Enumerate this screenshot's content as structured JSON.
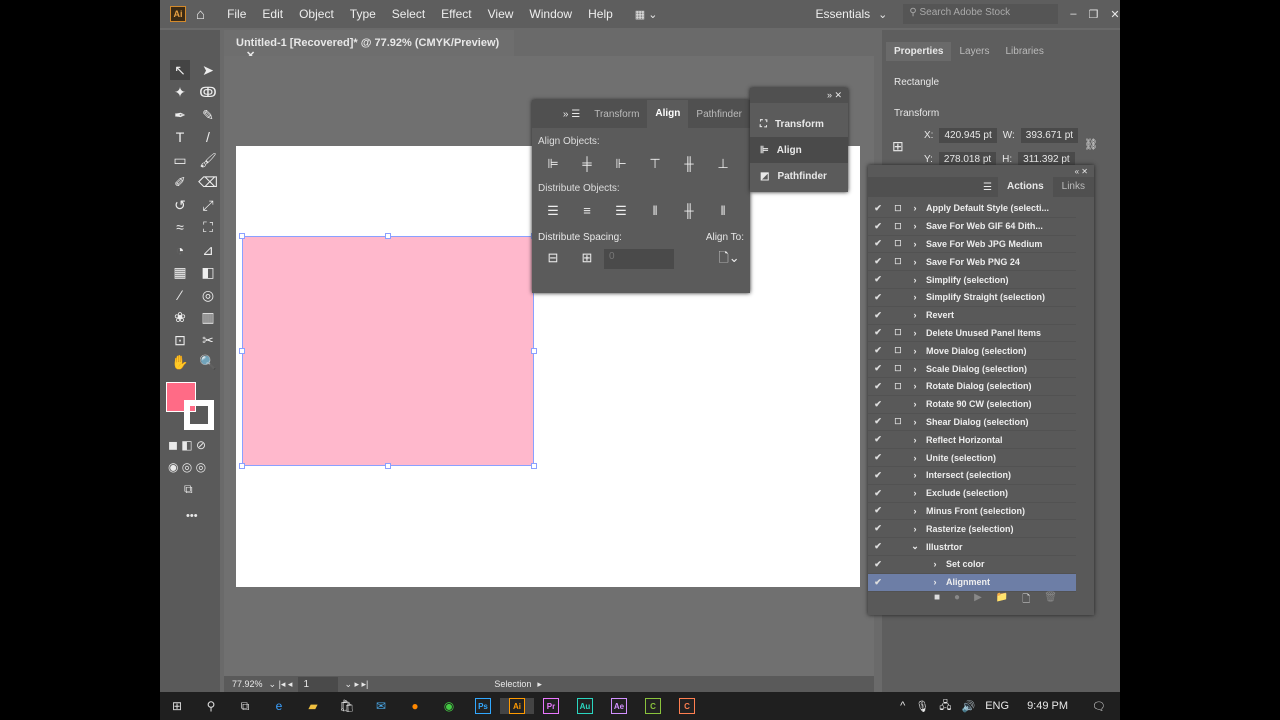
{
  "menubar": {
    "logo": "Ai",
    "items": [
      "File",
      "Edit",
      "Object",
      "Type",
      "Select",
      "Effect",
      "View",
      "Window",
      "Help"
    ],
    "workspace": "Essentials",
    "search_placeholder": "Search Adobe Stock"
  },
  "document": {
    "tab_title": "Untitled-1 [Recovered]* @ 77.92% (CMYK/Preview)",
    "fill_color": "#ffb8cc",
    "swatch_fill": "#ff6b86"
  },
  "align_panel": {
    "tabs": [
      "Transform",
      "Align",
      "Pathfinder"
    ],
    "active_tab": "Align",
    "align_objects": "Align Objects:",
    "distribute_objects": "Distribute Objects:",
    "distribute_spacing": "Distribute Spacing:",
    "align_to": "Align To:",
    "spacing_value": "0"
  },
  "flyout": {
    "items": [
      "Transform",
      "Align",
      "Pathfinder"
    ],
    "selected": "Align"
  },
  "properties": {
    "tabs": [
      "Properties",
      "Layers",
      "Libraries"
    ],
    "object_type": "Rectangle",
    "section": "Transform",
    "x_label": "X:",
    "x": "420.945 pt",
    "w_label": "W:",
    "w": "393.671 pt",
    "y_label": "Y:",
    "y": "278.018 pt",
    "h_label": "H:",
    "h": "311.392 pt"
  },
  "actions_panel": {
    "tabs": [
      "Actions",
      "Links"
    ],
    "items": [
      {
        "label": "Apply Default Style (selecti...",
        "dialog": true,
        "level": 0
      },
      {
        "label": "Save For Web GIF 64 Dith...",
        "dialog": true,
        "level": 0
      },
      {
        "label": "Save For Web JPG Medium",
        "dialog": true,
        "level": 0
      },
      {
        "label": "Save For Web PNG 24",
        "dialog": true,
        "level": 0
      },
      {
        "label": "Simplify (selection)",
        "dialog": false,
        "level": 0
      },
      {
        "label": "Simplify Straight (selection)",
        "dialog": false,
        "level": 0
      },
      {
        "label": "Revert",
        "dialog": false,
        "level": 0
      },
      {
        "label": "Delete Unused Panel Items",
        "dialog": true,
        "level": 0
      },
      {
        "label": "Move Dialog (selection)",
        "dialog": true,
        "level": 0
      },
      {
        "label": "Scale Dialog (selection)",
        "dialog": true,
        "level": 0
      },
      {
        "label": "Rotate Dialog (selection)",
        "dialog": true,
        "level": 0
      },
      {
        "label": "Rotate 90 CW (selection)",
        "dialog": false,
        "level": 0
      },
      {
        "label": "Shear Dialog (selection)",
        "dialog": true,
        "level": 0
      },
      {
        "label": "Reflect Horizontal",
        "dialog": false,
        "level": 0
      },
      {
        "label": "Unite (selection)",
        "dialog": false,
        "level": 0
      },
      {
        "label": "Intersect (selection)",
        "dialog": false,
        "level": 0
      },
      {
        "label": "Exclude (selection)",
        "dialog": false,
        "level": 0
      },
      {
        "label": "Minus Front (selection)",
        "dialog": false,
        "level": 0
      },
      {
        "label": "Rasterize (selection)",
        "dialog": false,
        "level": 0
      },
      {
        "label": "Illustrtor",
        "dialog": false,
        "level": 0,
        "open": true
      },
      {
        "label": "Set color",
        "dialog": false,
        "level": 1
      },
      {
        "label": "Alignment",
        "dialog": false,
        "level": 1,
        "selected": true
      }
    ]
  },
  "status": {
    "zoom": "77.92%",
    "artboard": "1",
    "tool": "Selection"
  },
  "taskbar": {
    "apps": [
      "Ps",
      "Ai",
      "Pr",
      "Au",
      "Ae",
      "C",
      "C"
    ],
    "language": "ENG",
    "time": "9:49 PM"
  }
}
